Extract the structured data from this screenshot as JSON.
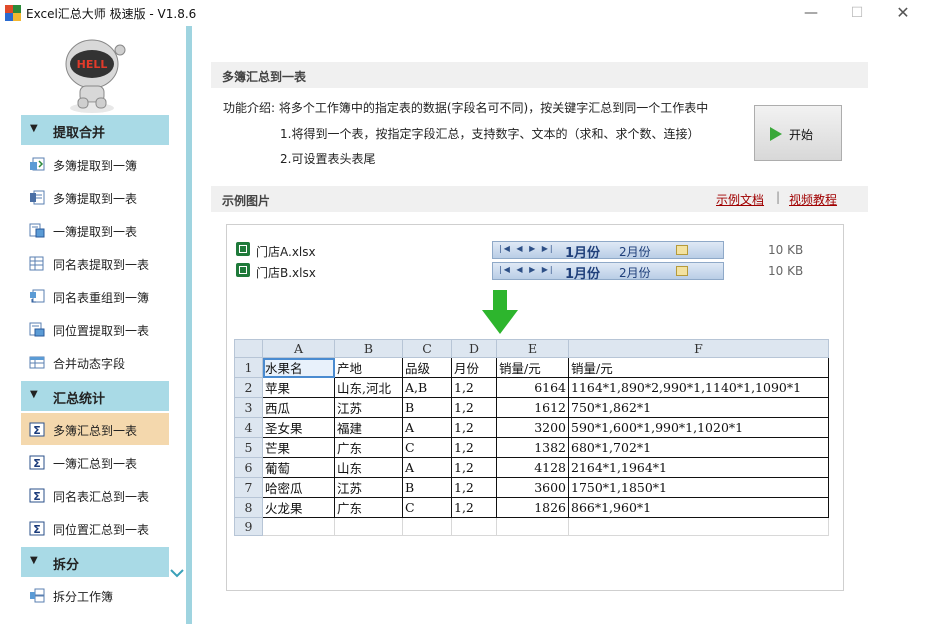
{
  "window": {
    "title": "Excel汇总大师 极速版 - V1.8.6",
    "minimize": "—",
    "maximize": "☐",
    "close": "✕"
  },
  "sidebar": {
    "sections": [
      {
        "title": "提取合并",
        "items": [
          {
            "label": "多簿提取到一簿",
            "icon": "extract-workbook-icon"
          },
          {
            "label": "多簿提取到一表",
            "icon": "extract-sheet-icon"
          },
          {
            "label": "一簿提取到一表",
            "icon": "extract-single-icon"
          },
          {
            "label": "同名表提取到一表",
            "icon": "same-name-extract-icon"
          },
          {
            "label": "同名表重组到一簿",
            "icon": "regroup-icon"
          },
          {
            "label": "同位置提取到一表",
            "icon": "same-position-extract-icon"
          },
          {
            "label": "合并动态字段",
            "icon": "merge-fields-icon"
          }
        ]
      },
      {
        "title": "汇总统计",
        "items": [
          {
            "label": "多簿汇总到一表",
            "icon": "sum-icon",
            "active": true
          },
          {
            "label": "一簿汇总到一表",
            "icon": "sum-icon"
          },
          {
            "label": "同名表汇总到一表",
            "icon": "sum-icon"
          },
          {
            "label": "同位置汇总到一表",
            "icon": "sum-icon"
          }
        ]
      },
      {
        "title": "拆分",
        "items": [
          {
            "label": "拆分工作簿",
            "icon": "split-icon"
          }
        ]
      }
    ],
    "mascot_text": "HELLO"
  },
  "main": {
    "header": "多簿汇总到一表",
    "description": "功能介绍: 将多个工作簿中的指定表的数据(字段名可不同)，按关键字汇总到同一个工作表中",
    "points": [
      "1.将得到一个表，按指定字段汇总，支持数字、文本的（求和、求个数、连接）",
      "2.可设置表头表尾"
    ],
    "start_button": "开始",
    "example_header": "示例图片",
    "links": {
      "doc": "示例文档",
      "separator": "|",
      "video": "视频教程"
    }
  },
  "example": {
    "files": [
      {
        "name": "门店A.xlsx",
        "tabs": [
          "1月份",
          "2月份"
        ],
        "size": "10 KB"
      },
      {
        "name": "门店B.xlsx",
        "tabs": [
          "1月份",
          "2月份"
        ],
        "size": "10 KB"
      }
    ],
    "nav_arrows": "|◀ ◀ ▶ ▶|",
    "sheet": {
      "columns": [
        "A",
        "B",
        "C",
        "D",
        "E",
        "F"
      ],
      "rows": [
        {
          "n": "1",
          "cells": [
            "水果名",
            "产地",
            "品级",
            "月份",
            "销量/元",
            "销量/元"
          ]
        },
        {
          "n": "2",
          "cells": [
            "苹果",
            "山东,河北",
            "A,B",
            "1,2",
            "6164",
            "1164*1,890*2,990*1,1140*1,1090*1"
          ]
        },
        {
          "n": "3",
          "cells": [
            "西瓜",
            "江苏",
            "B",
            "1,2",
            "1612",
            "750*1,862*1"
          ]
        },
        {
          "n": "4",
          "cells": [
            "圣女果",
            "福建",
            "A",
            "1,2",
            "3200",
            "590*1,600*1,990*1,1020*1"
          ]
        },
        {
          "n": "5",
          "cells": [
            "芒果",
            "广东",
            "C",
            "1,2",
            "1382",
            "680*1,702*1"
          ]
        },
        {
          "n": "6",
          "cells": [
            "葡萄",
            "山东",
            "A",
            "1,2",
            "4128",
            "2164*1,1964*1"
          ]
        },
        {
          "n": "7",
          "cells": [
            "哈密瓜",
            "江苏",
            "B",
            "1,2",
            "3600",
            "1750*1,1850*1"
          ]
        },
        {
          "n": "8",
          "cells": [
            "火龙果",
            "广东",
            "C",
            "1,2",
            "1826",
            "866*1,960*1"
          ]
        },
        {
          "n": "9",
          "cells": [
            "",
            "",
            "",
            "",
            "",
            ""
          ]
        }
      ]
    }
  },
  "colors": {
    "sidebar_section": "#a9dae6",
    "active_item": "#f4d8ad",
    "link": "#a00000",
    "arrow": "#2db52d"
  }
}
